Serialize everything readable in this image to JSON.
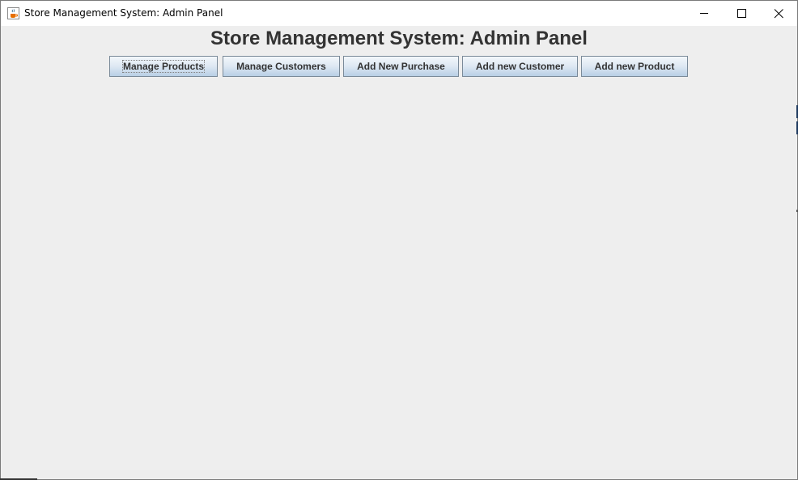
{
  "window": {
    "title": "Store Management System: Admin Panel",
    "icons": {
      "app": "java-coffee-cup-icon",
      "minimize": "minimize-icon",
      "maximize": "maximize-icon",
      "close": "close-icon"
    }
  },
  "panel": {
    "heading": "Store Management System: Admin Panel"
  },
  "toolbar": {
    "buttons": [
      {
        "label": "Manage Products",
        "focused": true
      },
      {
        "label": "Manage Customers",
        "focused": false
      },
      {
        "label": "Add New Purchase",
        "focused": false
      },
      {
        "label": "Add new Customer",
        "focused": false
      },
      {
        "label": "Add new Product",
        "focused": false
      }
    ]
  },
  "colors": {
    "background": "#eeeeee",
    "heading_text": "#333333",
    "button_border": "#7a8a99"
  }
}
